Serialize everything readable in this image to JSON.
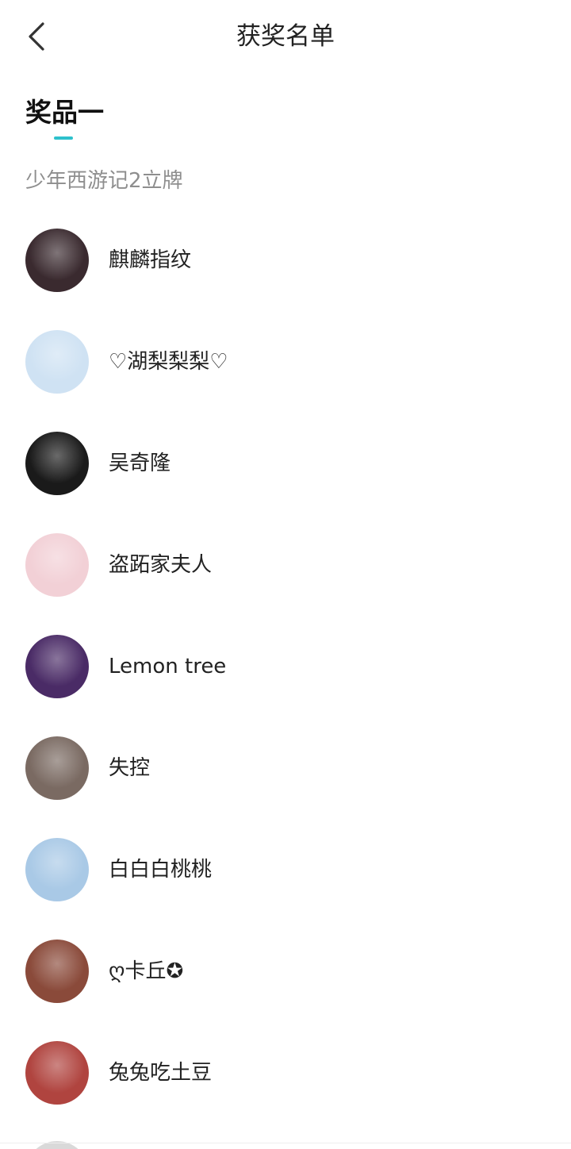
{
  "header": {
    "back_icon": "chevron-left-icon",
    "title": "获奖名单"
  },
  "tab": {
    "label": "奖品一",
    "indicator_color": "#2ec1cc"
  },
  "prize": {
    "name": "少年西游记2立牌"
  },
  "winners": [
    {
      "name": "麒麟指纹",
      "avatar_color": "#3a2a2f"
    },
    {
      "name": "♡湖梨梨梨♡",
      "avatar_color": "#cfe2f3"
    },
    {
      "name": "吴奇隆",
      "avatar_color": "#1a1a1a"
    },
    {
      "name": "盗跖家夫人",
      "avatar_color": "#f2d0d6"
    },
    {
      "name": "Lemon tree",
      "avatar_color": "#4a2b66"
    },
    {
      "name": "失控",
      "avatar_color": "#7a6a62"
    },
    {
      "name": "白白白桃桃",
      "avatar_color": "#a9c9e6"
    },
    {
      "name": "ღ卡丘✪",
      "avatar_color": "#8a4a3a"
    },
    {
      "name": "兔兔吃土豆",
      "avatar_color": "#b0443f"
    }
  ]
}
